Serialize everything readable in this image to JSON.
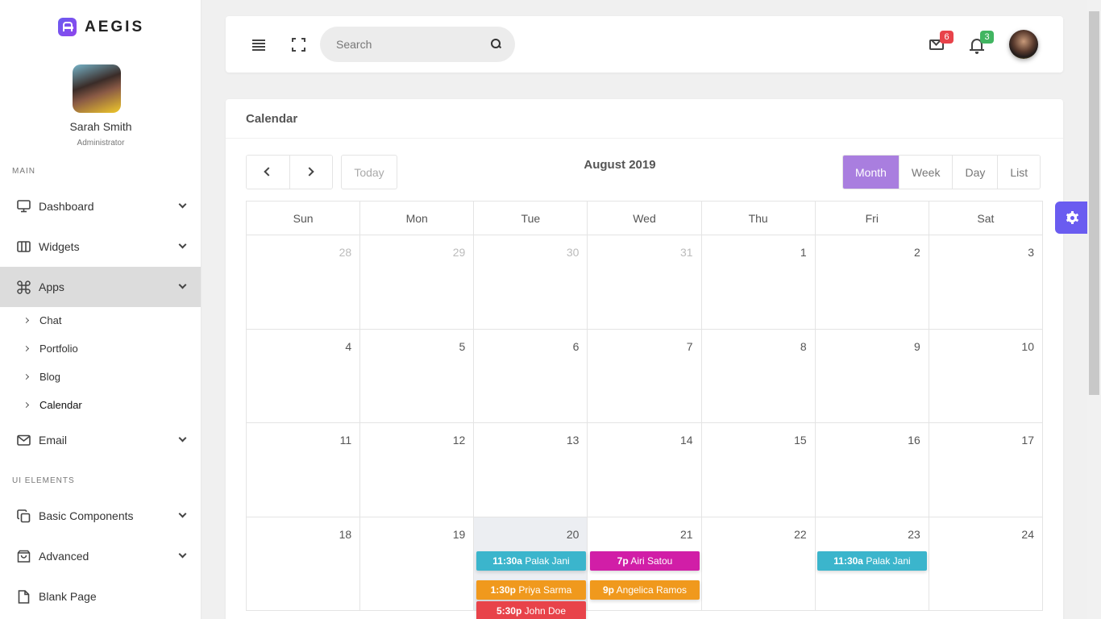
{
  "brand": {
    "name": "AEGIS"
  },
  "profile": {
    "name": "Sarah Smith",
    "role": "Administrator"
  },
  "sidebar": {
    "section_main": "MAIN",
    "section_ui": "UI ELEMENTS",
    "items": {
      "dashboard": "Dashboard",
      "widgets": "Widgets",
      "apps": "Apps",
      "email": "Email",
      "basic": "Basic Components",
      "advanced": "Advanced",
      "blank": "Blank Page"
    },
    "apps_sub": {
      "chat": "Chat",
      "portfolio": "Portfolio",
      "blog": "Blog",
      "calendar": "Calendar"
    }
  },
  "header": {
    "search_placeholder": "Search",
    "mail_count": "6",
    "notif_count": "3"
  },
  "calendar": {
    "card_title": "Calendar",
    "today_label": "Today",
    "title": "August 2019",
    "views": {
      "month": "Month",
      "week": "Week",
      "day": "Day",
      "list": "List"
    },
    "weekdays": [
      "Sun",
      "Mon",
      "Tue",
      "Wed",
      "Thu",
      "Fri",
      "Sat"
    ],
    "weeks": [
      [
        "28",
        "29",
        "30",
        "31",
        "1",
        "2",
        "3"
      ],
      [
        "4",
        "5",
        "6",
        "7",
        "8",
        "9",
        "10"
      ],
      [
        "11",
        "12",
        "13",
        "14",
        "15",
        "16",
        "17"
      ],
      [
        "18",
        "19",
        "20",
        "21",
        "22",
        "23",
        "24"
      ]
    ],
    "events": [
      {
        "time": "11:30a",
        "title": "Palak Jani",
        "color": "#3bb5cc"
      },
      {
        "time": "7p",
        "title": "Airi Satou",
        "color": "#d11ea7"
      },
      {
        "time": "11:30a",
        "title": "Palak Jani",
        "color": "#3bb5cc"
      },
      {
        "time": "1:30p",
        "title": "Priya Sarma",
        "color": "#f0991d"
      },
      {
        "time": "9p",
        "title": "Angelica Ramos",
        "color": "#f0991d"
      },
      {
        "time": "5:30p",
        "title": "John Doe",
        "color": "#e8434a"
      }
    ]
  }
}
